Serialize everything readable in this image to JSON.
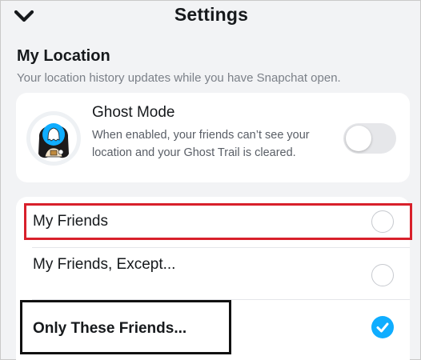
{
  "header": {
    "title": "Settings",
    "back_icon": "chevron-down-icon"
  },
  "location": {
    "title": "My Location",
    "subtitle": "Your location history updates while you have Snapchat open."
  },
  "ghost_mode": {
    "title": "Ghost Mode",
    "description": "When enabled, your friends can’t see your location and your Ghost Trail is cleared.",
    "enabled": false,
    "avatar_icon": "bitmoji-avatar-icon"
  },
  "options": [
    {
      "label": "My Friends",
      "selected": false
    },
    {
      "label": "My Friends, Except...",
      "selected": false
    },
    {
      "label": "Only These Friends...",
      "selected": true
    }
  ],
  "colors": {
    "accent": "#0fadff",
    "highlight_red": "#d8202b",
    "highlight_black": "#111111"
  }
}
